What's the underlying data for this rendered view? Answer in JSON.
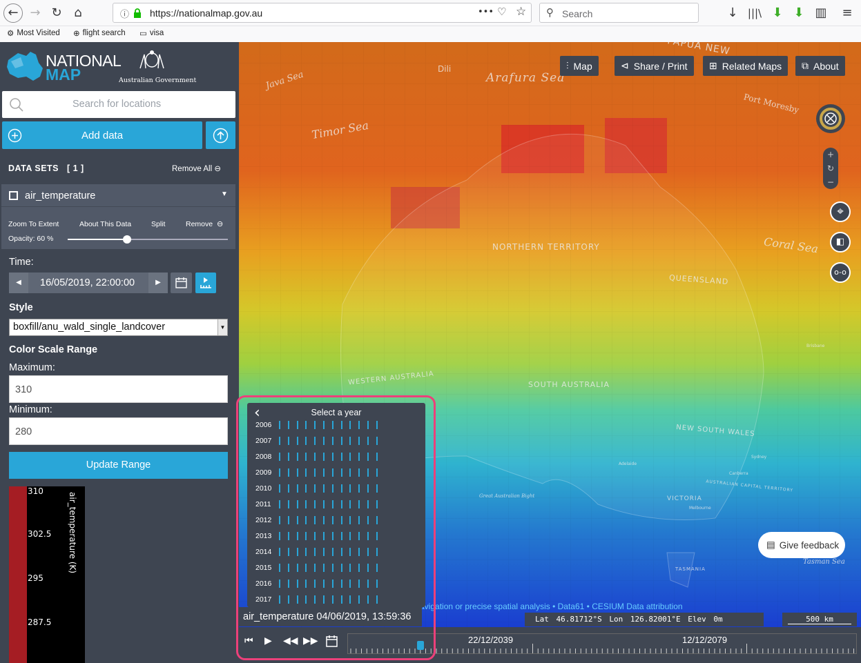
{
  "browser": {
    "url": "https://nationalmap.gov.au",
    "search_placeholder": "Search",
    "url_actions": "•••",
    "bookmarks": [
      "Most Visited",
      "flight search",
      "visa"
    ]
  },
  "sidebar": {
    "logo_line1": "NATIONAL",
    "logo_line2": "MAP",
    "gov_text": "Australian Government",
    "search_placeholder": "Search for locations",
    "add_data_label": "Add data",
    "datasets_label": "DATA SETS",
    "datasets_count": "[ 1 ]",
    "remove_all_label": "Remove All",
    "dataset": {
      "name": "air_temperature",
      "options": [
        "Zoom To Extent",
        "About This Data",
        "Split",
        "Remove"
      ],
      "opacity_label": "Opacity: 60 %",
      "opacity_value": 60,
      "time_label": "Time:",
      "time_value": "16/05/2019, 22:00:00",
      "style_label": "Style",
      "style_value": "boxfill/anu_wald_single_landcover",
      "color_scale_label": "Color Scale Range",
      "max_label": "Maximum:",
      "max_value": "310",
      "min_label": "Minimum:",
      "min_value": "280",
      "update_label": "Update Range"
    },
    "legend": {
      "values": [
        "310",
        "302.5",
        "295",
        "287.5"
      ],
      "title": "air_temperature (K)"
    }
  },
  "map": {
    "buttons": [
      "Map",
      "Share / Print",
      "Related Maps",
      "About"
    ],
    "labels": {
      "java_sea": "Java Sea",
      "dili": "Dili",
      "arafura": "Arafura Sea",
      "timor": "Timor Sea",
      "png": "PAPUA NEW",
      "port": "Port Moresby",
      "coral": "Coral Sea",
      "nt": "NORTHERN TERRITORY",
      "qld": "QUEENSLAND",
      "wa": "WESTERN AUSTRALIA",
      "sa": "SOUTH AUSTRALIA",
      "nsw": "NEW SOUTH WALES",
      "gab": "Great Australian Bight",
      "vic": "VICTORIA",
      "act": "AUSTRALIAN CAPITAL TERRITORY",
      "tas": "TASMANIA",
      "tasman": "Tasman Sea",
      "adelaide": "Adelaide",
      "melbourne": "Melbourne",
      "sydney": "Sydney",
      "canberra": "Canberra",
      "brisbane": "Brisbane"
    },
    "feedback_label": "Give feedback",
    "credits": "avigation or precise spatial analysis • Data61 • CESIUM  Data attribution",
    "latlon": "Lat  46.81712°S   Lon  126.82001°E  Elev  0m",
    "scale": "500 km"
  },
  "year_picker": {
    "title": "Select a year",
    "years": [
      "2006",
      "2007",
      "2008",
      "2009",
      "2010",
      "2011",
      "2012",
      "2013",
      "2014",
      "2015",
      "2016",
      "2017"
    ]
  },
  "timeline": {
    "current_label": "air_temperature 04/06/2019, 13:59:36",
    "ticks": [
      "22/12/2039",
      "12/12/2079"
    ],
    "playhead_position": 0.142
  }
}
